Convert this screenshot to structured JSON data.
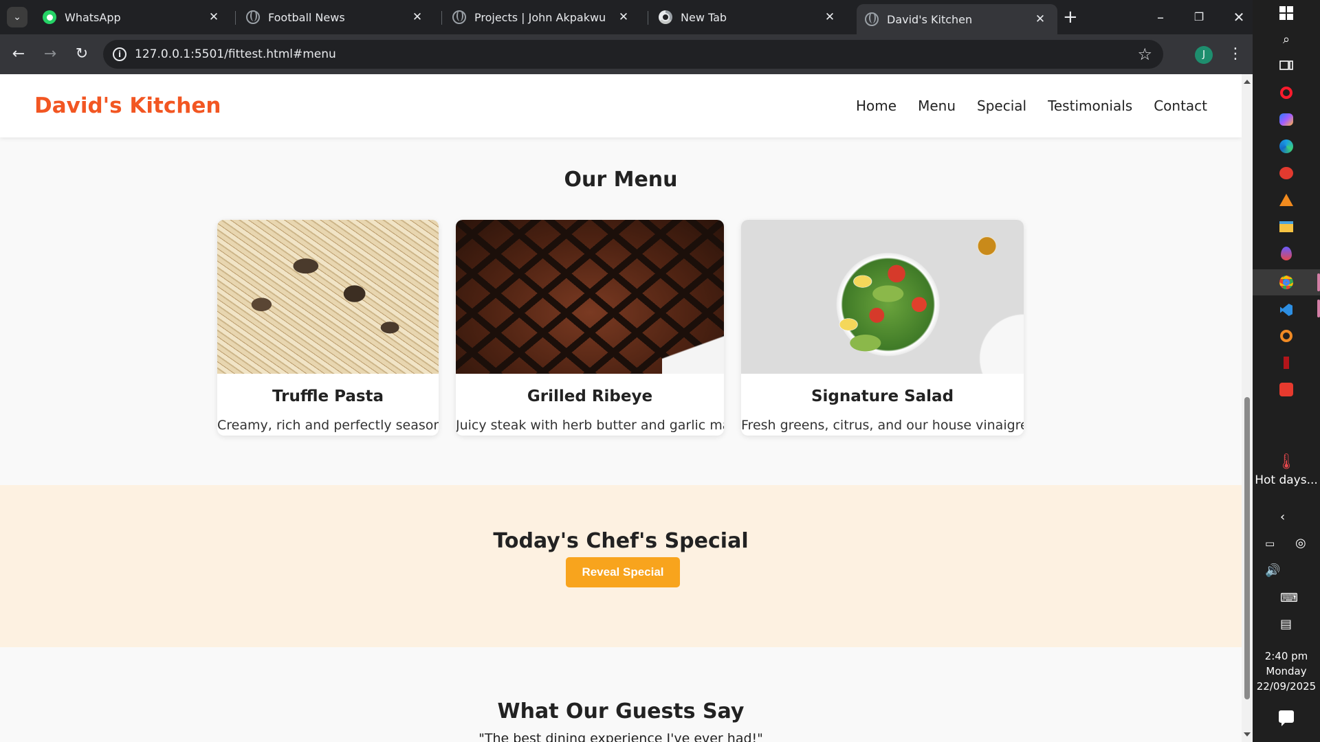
{
  "browser": {
    "tabs": [
      {
        "title": "WhatsApp",
        "favicon": "whatsapp-icon"
      },
      {
        "title": "Football News",
        "favicon": "globe-icon"
      },
      {
        "title": "Projects | John Akpakwu",
        "favicon": "globe-icon"
      },
      {
        "title": "New Tab",
        "favicon": "chrome-icon"
      },
      {
        "title": "David's Kitchen",
        "favicon": "globe-icon",
        "active": true
      }
    ],
    "url": "127.0.0.1:5501/fittest.html#menu",
    "profile_initial": "J"
  },
  "site": {
    "brand": "David's Kitchen",
    "brand_color": "#f25622",
    "nav": [
      "Home",
      "Menu",
      "Special",
      "Testimonials",
      "Contact"
    ]
  },
  "menu": {
    "title": "Our Menu",
    "items": [
      {
        "name": "Truffle Pasta",
        "description": "Creamy, rich and perfectly seasoned",
        "image": "pasta-photo"
      },
      {
        "name": "Grilled Ribeye",
        "description": "Juicy steak with herb butter and garlic mash",
        "image": "steak-photo"
      },
      {
        "name": "Signature Salad",
        "description": "Fresh greens, citrus, and our house vinaigrette",
        "image": "salad-photo"
      }
    ]
  },
  "special": {
    "title": "Today's Chef's Special",
    "button_label": "Reveal Special",
    "button_color": "#f8a41d",
    "background": "#fdf1e1"
  },
  "testimonials": {
    "title": "What Our Guests Say",
    "quote": "\"The best dining experience I've ever had!\""
  },
  "taskbar": {
    "weather_text": "Hot days...",
    "time": "2:40 pm",
    "day": "Monday",
    "date": "22/09/2025"
  }
}
